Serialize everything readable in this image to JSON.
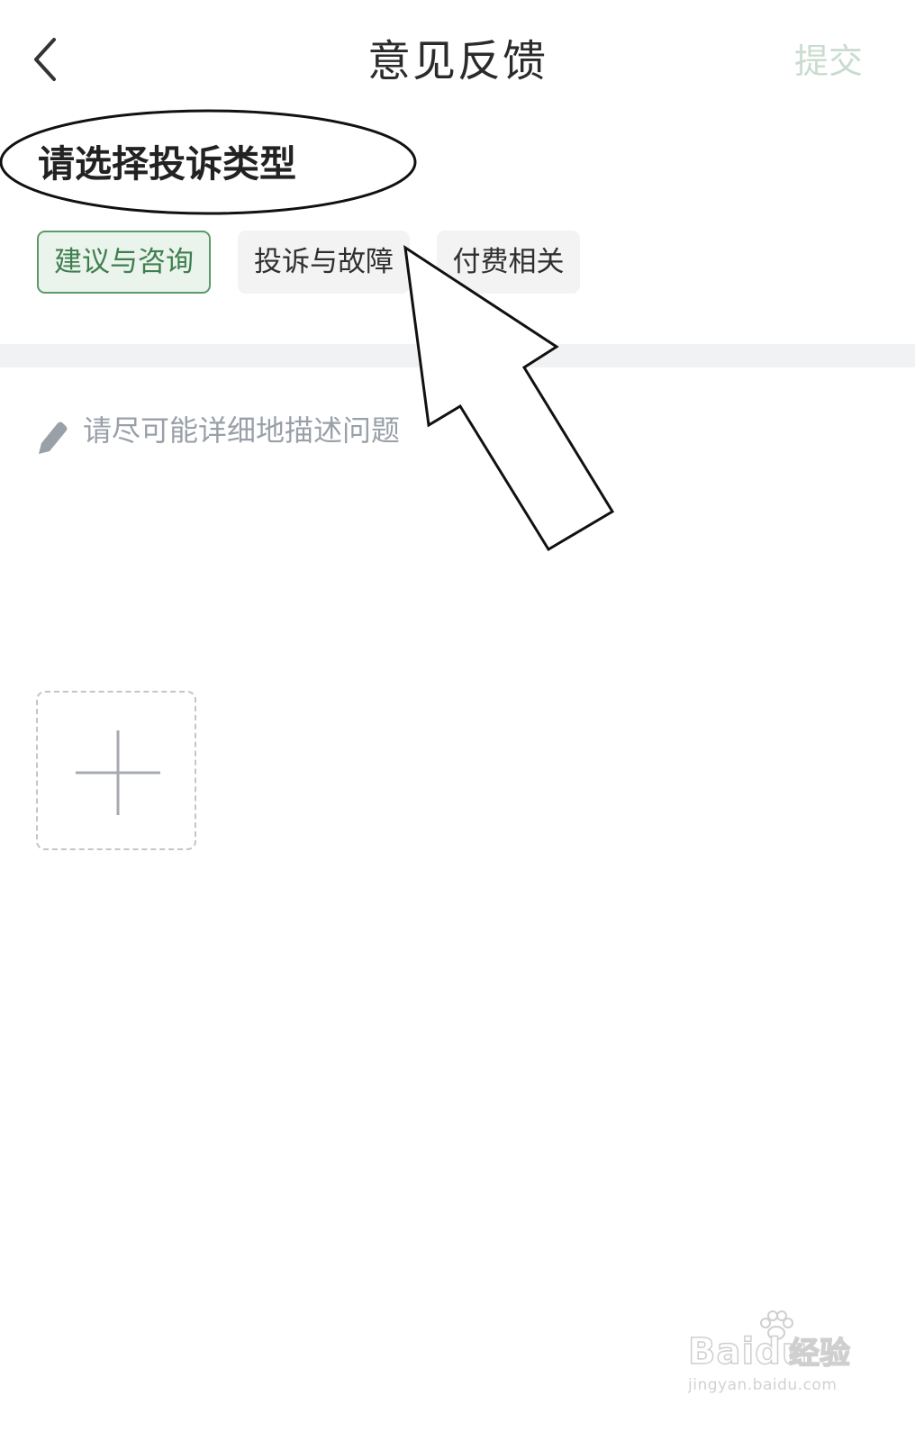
{
  "header": {
    "title": "意见反馈",
    "submit_label": "提交",
    "back_icon": "chevron-left-icon"
  },
  "complaint_type": {
    "heading": "请选择投诉类型",
    "options": [
      {
        "label": "建议与咨询",
        "selected": true
      },
      {
        "label": "投诉与故障",
        "selected": false
      },
      {
        "label": "付费相关",
        "selected": false
      }
    ]
  },
  "description": {
    "icon": "pencil-icon",
    "placeholder": "请尽可能详细地描述问题"
  },
  "attachment": {
    "icon": "plus-icon"
  },
  "watermark": {
    "brand": "Baidu",
    "brand_cn": "经验",
    "url": "jingyan.baidu.com"
  },
  "colors": {
    "accent_green": "#5c9a6a",
    "submit_disabled": "#c9dccf",
    "placeholder_gray": "#9aa0a8"
  }
}
